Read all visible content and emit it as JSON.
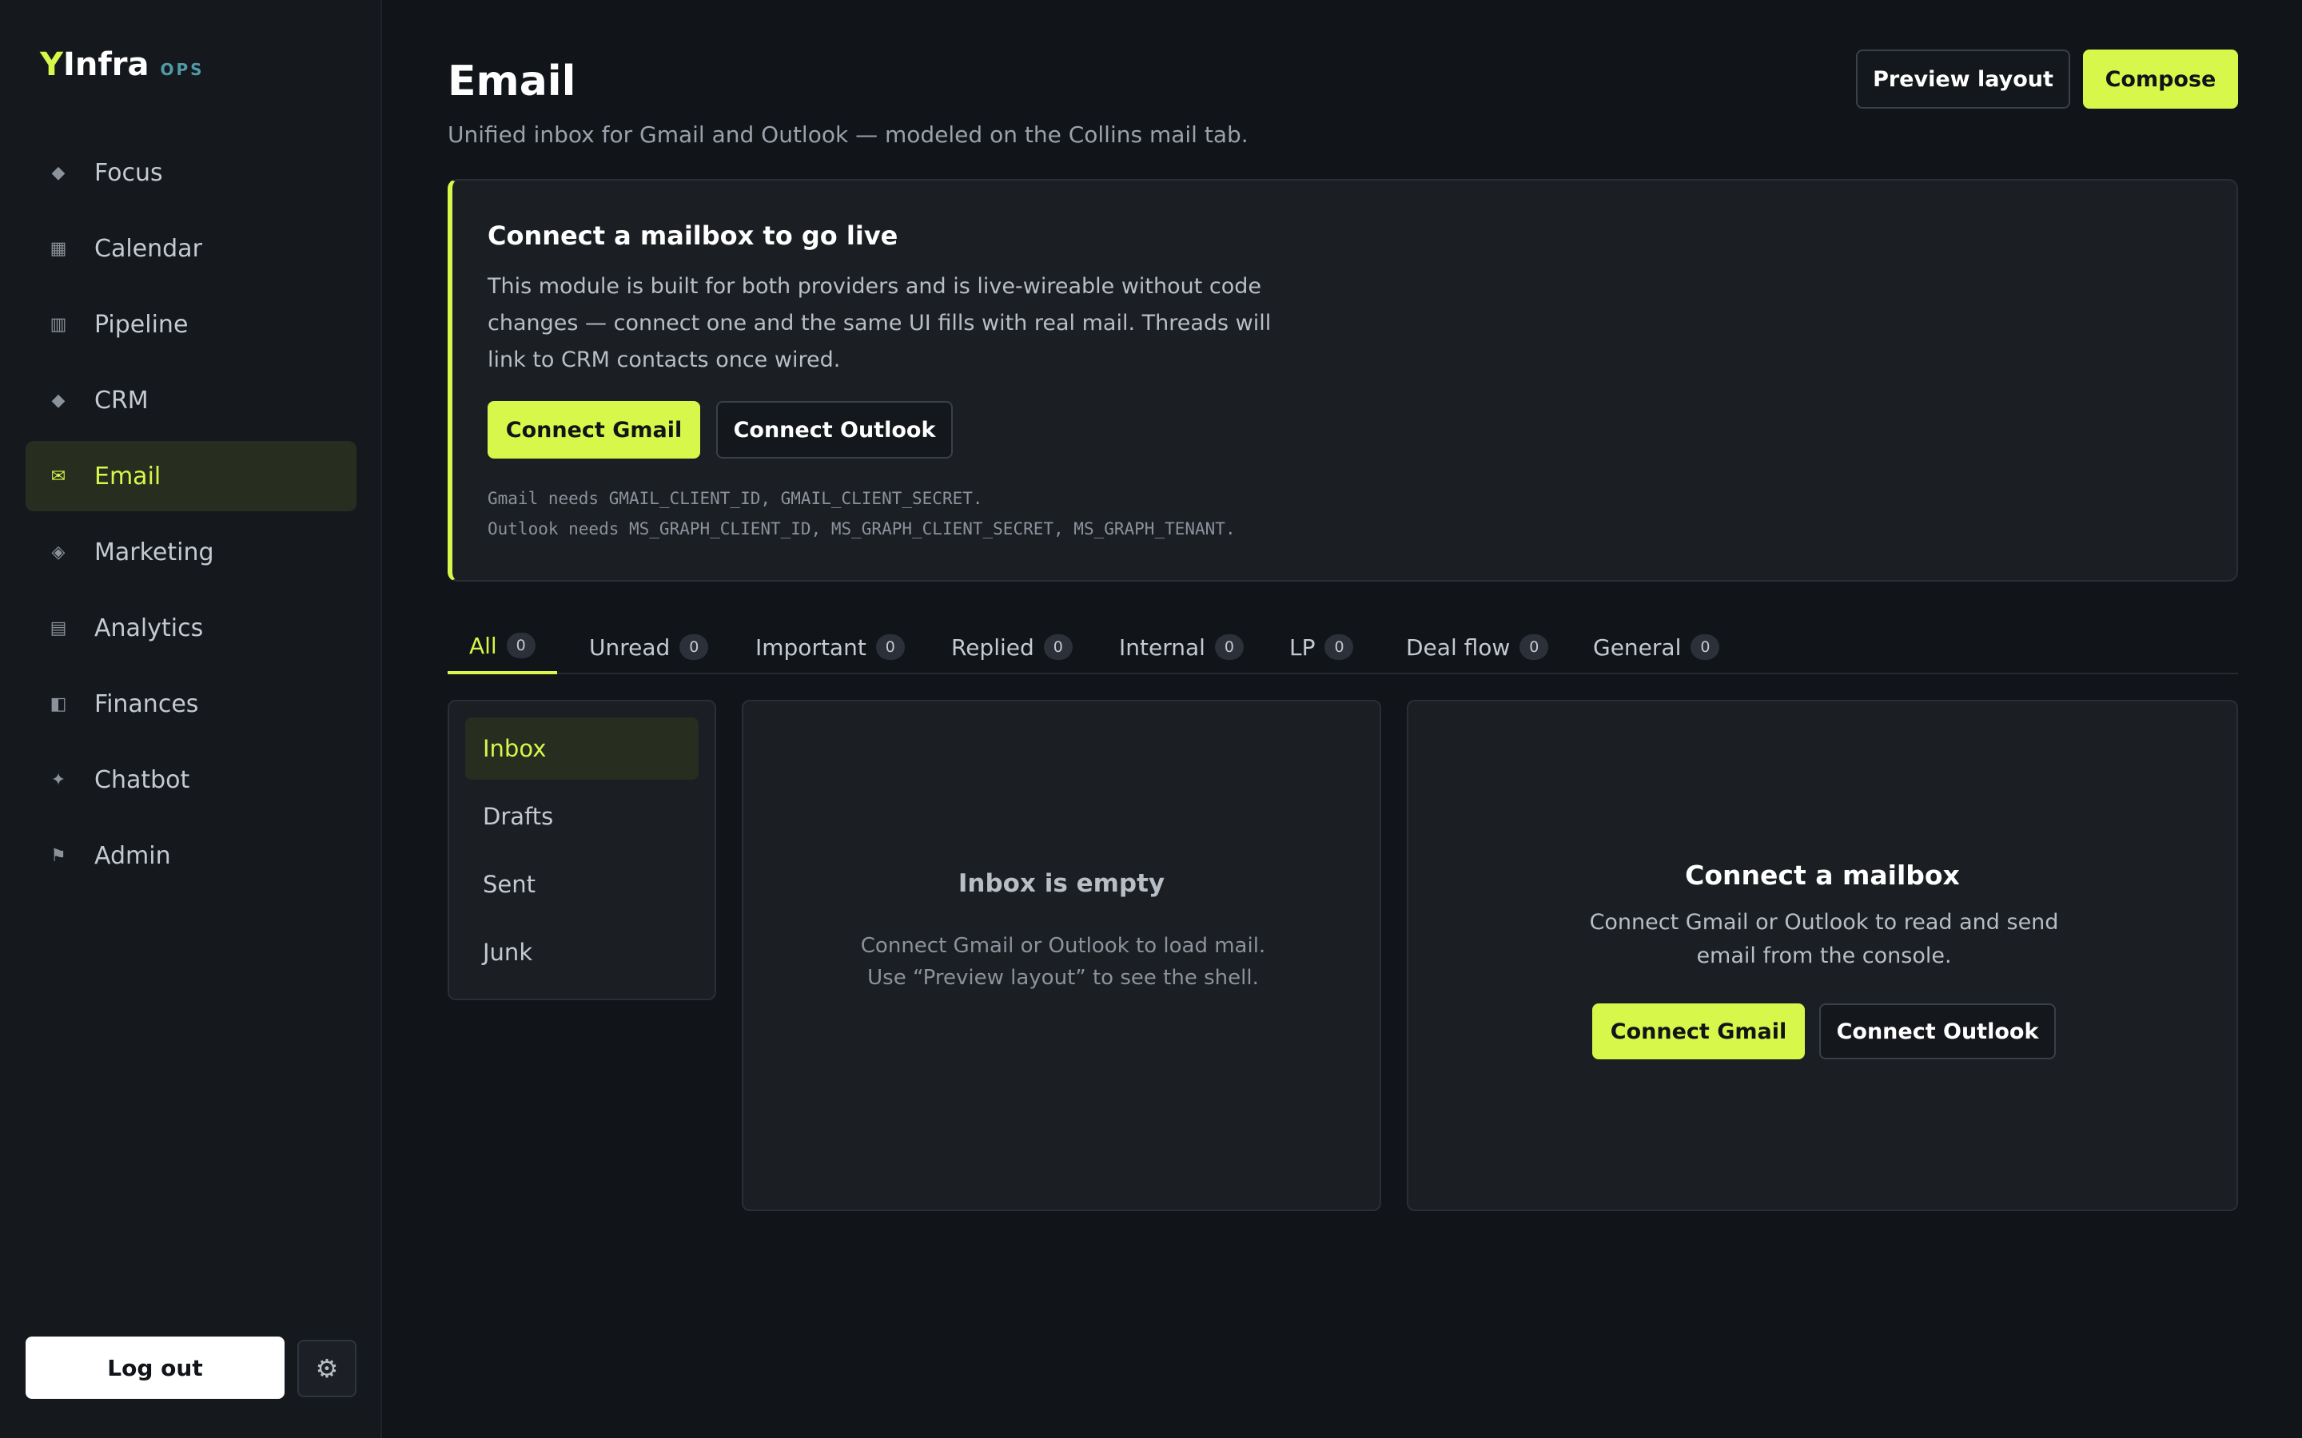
{
  "brand": {
    "y": "Y",
    "name": "Infra",
    "tag": "OPS"
  },
  "sidebar": {
    "items": [
      {
        "label": "Focus",
        "icon": "◆"
      },
      {
        "label": "Calendar",
        "icon": "▦"
      },
      {
        "label": "Pipeline",
        "icon": "▥"
      },
      {
        "label": "CRM",
        "icon": "◆"
      },
      {
        "label": "Email",
        "icon": "✉"
      },
      {
        "label": "Marketing",
        "icon": "◈"
      },
      {
        "label": "Analytics",
        "icon": "▤"
      },
      {
        "label": "Finances",
        "icon": "◧"
      },
      {
        "label": "Chatbot",
        "icon": "✦"
      },
      {
        "label": "Admin",
        "icon": "⚑"
      }
    ],
    "logout_label": "Log out",
    "settings_icon": "⚙"
  },
  "header": {
    "title": "Email",
    "subtitle": "Unified inbox for Gmail and Outlook — modeled on the Collins mail tab.",
    "preview_label": "Preview layout",
    "compose_label": "Compose"
  },
  "banner": {
    "title": "Connect a mailbox to go live",
    "text": "This module is built for both providers and is live-wireable without code changes — connect one and the same UI fills with real mail. Threads will link to CRM contacts once wired.",
    "gmail_label": "Connect Gmail",
    "outlook_label": "Connect Outlook",
    "gmail_env": "Gmail needs GMAIL_CLIENT_ID, GMAIL_CLIENT_SECRET.",
    "outlook_env": "Outlook needs MS_GRAPH_CLIENT_ID, MS_GRAPH_CLIENT_SECRET, MS_GRAPH_TENANT."
  },
  "tabs": [
    {
      "label": "All",
      "count": "0"
    },
    {
      "label": "Unread",
      "count": "0"
    },
    {
      "label": "Important",
      "count": "0"
    },
    {
      "label": "Replied",
      "count": "0"
    },
    {
      "label": "Internal",
      "count": "0"
    },
    {
      "label": "LP",
      "count": "0"
    },
    {
      "label": "Deal flow",
      "count": "0"
    },
    {
      "label": "General",
      "count": "0"
    }
  ],
  "folders": [
    "Inbox",
    "Drafts",
    "Sent",
    "Junk"
  ],
  "inbox": {
    "empty_title": "Inbox is empty",
    "empty_text": "Connect Gmail or Outlook to load mail. Use “Preview layout” to see the shell."
  },
  "connect": {
    "title": "Connect a mailbox",
    "text": "Connect Gmail or Outlook to read and send email from the console.",
    "gmail_label": "Connect Gmail",
    "outlook_label": "Connect Outlook"
  },
  "colors": {
    "accent": "#d7f74a",
    "background": "#111419",
    "panel": "#1b1e23"
  }
}
